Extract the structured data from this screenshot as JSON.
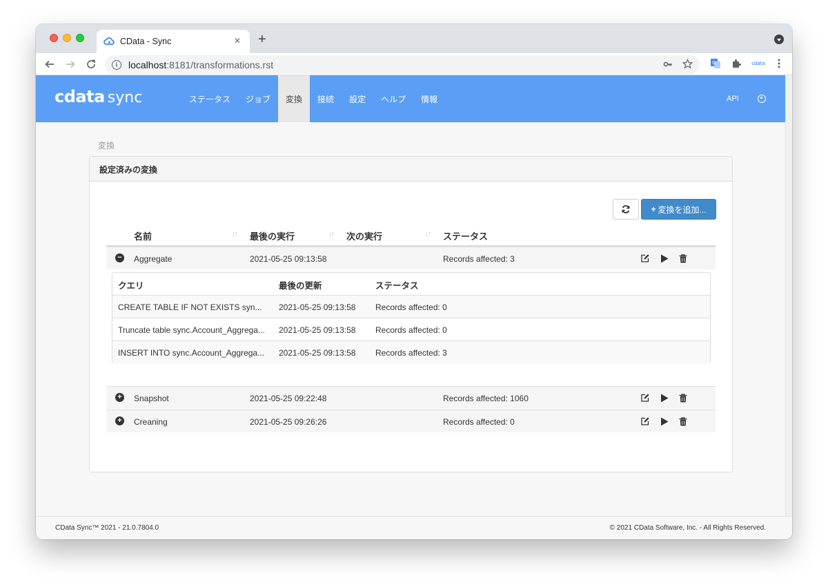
{
  "browser": {
    "tab_title": "CData - Sync",
    "tab_close": "×",
    "new_tab": "+",
    "url_host": "localhost",
    "url_path": ":8181/transformations.rst",
    "ext_cdata_label": "cdata"
  },
  "header": {
    "logo_cdata": "cdata",
    "logo_sync": "sync",
    "nav": [
      {
        "label": "ステータス"
      },
      {
        "label": "ジョブ"
      },
      {
        "label": "変換"
      },
      {
        "label": "接続"
      },
      {
        "label": "設定"
      },
      {
        "label": "ヘルプ"
      },
      {
        "label": "情報"
      }
    ],
    "active_nav": "変換",
    "api_label": "API"
  },
  "page": {
    "breadcrumb": "変換",
    "panel_title": "設定済みの変換",
    "add_button": "変換を追加...",
    "add_plus": "+"
  },
  "table": {
    "columns": [
      "名前",
      "最後の実行",
      "次の実行",
      "ステータス"
    ],
    "rows": [
      {
        "name": "Aggregate",
        "last_run": "2021-05-25 09:13:58",
        "next_run": "",
        "status": "Records affected: 3",
        "expanded": true
      },
      {
        "name": "Snapshot",
        "last_run": "2021-05-25 09:22:48",
        "next_run": "",
        "status": "Records affected: 1060",
        "expanded": false
      },
      {
        "name": "Creaning",
        "last_run": "2021-05-25 09:26:26",
        "next_run": "",
        "status": "Records affected: 0",
        "expanded": false
      }
    ]
  },
  "subtable": {
    "columns": [
      "クエリ",
      "最後の更新",
      "ステータス"
    ],
    "rows": [
      {
        "query": "CREATE TABLE IF NOT EXISTS syn...",
        "updated": "2021-05-25 09:13:58",
        "status": "Records affected: 0"
      },
      {
        "query": "Truncate table sync.Account_Aggrega...",
        "updated": "2021-05-25 09:13:58",
        "status": "Records affected: 0"
      },
      {
        "query": "INSERT INTO sync.Account_Aggrega...",
        "updated": "2021-05-25 09:13:58",
        "status": "Records affected: 3"
      }
    ]
  },
  "footer": {
    "left": "CData Sync™ 2021 - 21.0.7804.0",
    "right": "© 2021 CData Software, Inc. - All Rights Reserved."
  },
  "colors": {
    "header_bg": "#5b9ef5",
    "primary_button": "#428bca"
  }
}
